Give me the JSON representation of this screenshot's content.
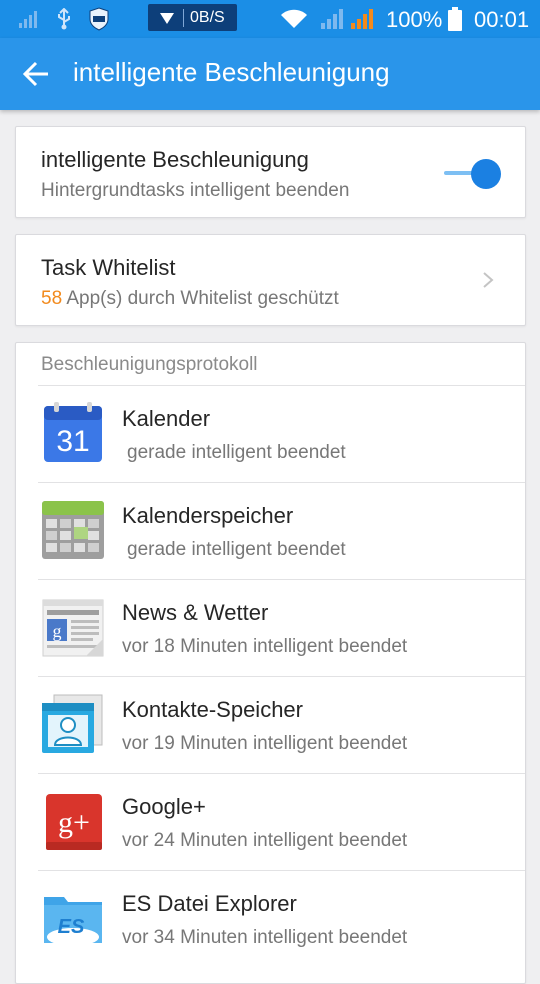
{
  "status_bar": {
    "network_speed": "0B/S",
    "battery": "100%",
    "time": "00:01",
    "icons": [
      "data-signal-icon",
      "usb-icon",
      "lbe-shield-icon",
      "wifi-icon",
      "signal-icon",
      "signal-orange-icon",
      "battery-icon"
    ]
  },
  "app_bar": {
    "title": "intelligente Beschleunigung",
    "back_icon": "arrow-left-icon"
  },
  "smart_boost": {
    "title": "intelligente Beschleunigung",
    "subtitle": "Hintergrundtasks intelligent beenden",
    "enabled": true
  },
  "whitelist": {
    "title": "Task Whitelist",
    "count": "58",
    "subtitle_rest": " App(s) durch Whitelist geschützt"
  },
  "log": {
    "header": "Beschleunigungsprotokoll",
    "items": [
      {
        "name": "Kalender",
        "time": "gerade intelligent beendet",
        "icon": "calendar-icon"
      },
      {
        "name": "Kalenderspeicher",
        "time": "gerade intelligent beendet",
        "icon": "calendar-storage-icon"
      },
      {
        "name": "News & Wetter",
        "time": "vor 18 Minuten intelligent beendet",
        "icon": "news-weather-icon"
      },
      {
        "name": "Kontakte-Speicher",
        "time": "vor 19 Minuten intelligent beendet",
        "icon": "contacts-storage-icon"
      },
      {
        "name": "Google+",
        "time": "vor 24 Minuten intelligent beendet",
        "icon": "google-plus-icon"
      },
      {
        "name": "ES Datei Explorer",
        "time": "vor 34 Minuten intelligent beendet",
        "icon": "es-file-explorer-icon"
      }
    ]
  },
  "calendar_icon_text": "31",
  "google_plus_icon_text": "g+",
  "es_icon_text": "ES",
  "colors": {
    "status_bar": "#1b8ee6",
    "app_bar": "#2a95ea",
    "accent": "#1b80e2",
    "whitelist_count": "#f28a1d"
  }
}
